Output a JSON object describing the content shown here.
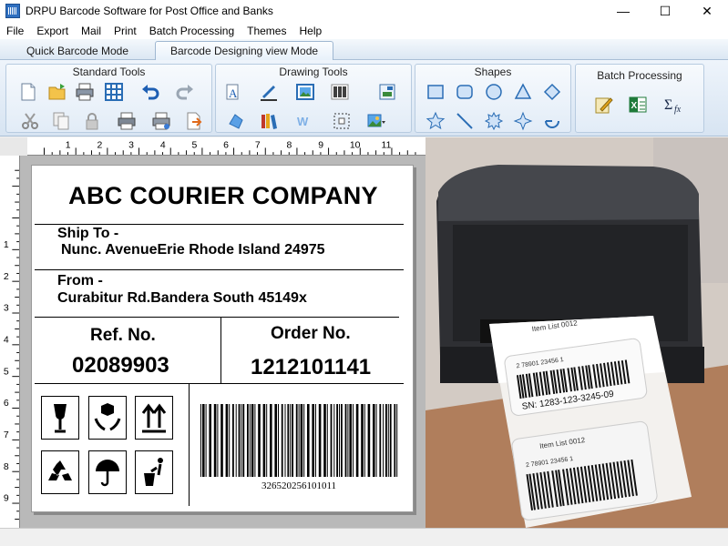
{
  "window": {
    "title": "DRPU Barcode Software for Post Office and Banks",
    "minimize_glyph": "—",
    "maximize_glyph": "☐",
    "close_glyph": "✕"
  },
  "menu": {
    "items": [
      "File",
      "Export",
      "Mail",
      "Print",
      "Batch Processing",
      "Themes",
      "Help"
    ]
  },
  "tabs": [
    {
      "label": "Quick Barcode Mode",
      "active": false
    },
    {
      "label": "Barcode Designing view Mode",
      "active": true
    }
  ],
  "ribbon": {
    "groups": [
      {
        "label": "Standard Tools",
        "icons": [
          "new-icon",
          "open-icon",
          "print-icon",
          "grid-icon",
          "undo-icon",
          "redo-icon",
          "cut-icon",
          "copy-icon",
          "lock-icon",
          "print-preview-icon",
          "print-setup-icon",
          "export-icon"
        ]
      },
      {
        "label": "Drawing Tools",
        "icons": [
          "text-icon",
          "pen-icon",
          "picture-icon",
          "barcode-icon",
          "image-export-icon",
          "shape-fill-icon",
          "books-icon",
          "watermark-icon",
          "select-icon",
          "image-dropdown-icon"
        ]
      },
      {
        "label": "Shapes",
        "icons": [
          "rectangle-icon",
          "rounded-rectangle-icon",
          "ellipse-icon",
          "triangle-icon",
          "diamond-icon",
          "star-icon",
          "line-icon",
          "burst-icon",
          "four-point-star-icon",
          "arc-icon"
        ]
      },
      {
        "label": "Batch Processing",
        "icons": [
          "batch-edit-icon",
          "excel-icon",
          "formula-icon"
        ]
      }
    ]
  },
  "ruler": {
    "h_numbers": [
      "1",
      "2",
      "3",
      "4",
      "5",
      "6",
      "7",
      "8",
      "9",
      "10",
      "11"
    ],
    "v_numbers": [
      "1",
      "2",
      "3",
      "4",
      "5",
      "6",
      "7",
      "8",
      "9"
    ]
  },
  "label": {
    "company": "ABC COURIER COMPANY",
    "ship_to_label": "Ship To -",
    "ship_to_address": "Nunc. AvenueErie Rhode Island 24975",
    "from_label": "From -",
    "from_address": "Curabitur Rd.Bandera South 45149x",
    "ref_label": "Ref. No.",
    "ref_value": "02089903",
    "order_label": "Order No.",
    "order_value": "1212101141",
    "barcode_text": "326520256101011",
    "symbols": [
      "fragile-icon",
      "handle-with-care-icon",
      "this-side-up-icon",
      "recycle-icon",
      "keep-dry-icon",
      "dispose-properly-icon"
    ]
  },
  "photo": {
    "label_text_1": "SN: 1283-123-3245-09",
    "item_text": "Item List 0012",
    "numbers_line": "2   78901   23456   1"
  }
}
